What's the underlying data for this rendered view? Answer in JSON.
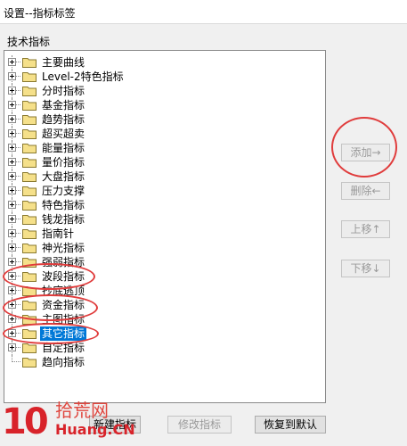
{
  "window": {
    "title": "设置--指标标签"
  },
  "group_label": "技术指标",
  "tree": {
    "items": [
      {
        "label": "主要曲线",
        "selected": false,
        "expandable": true
      },
      {
        "label": "Level-2特色指标",
        "selected": false,
        "expandable": true
      },
      {
        "label": "分时指标",
        "selected": false,
        "expandable": true
      },
      {
        "label": "基金指标",
        "selected": false,
        "expandable": true
      },
      {
        "label": "趋势指标",
        "selected": false,
        "expandable": true
      },
      {
        "label": "超买超卖",
        "selected": false,
        "expandable": true
      },
      {
        "label": "能量指标",
        "selected": false,
        "expandable": true
      },
      {
        "label": "量价指标",
        "selected": false,
        "expandable": true
      },
      {
        "label": "大盘指标",
        "selected": false,
        "expandable": true
      },
      {
        "label": "压力支撑",
        "selected": false,
        "expandable": true
      },
      {
        "label": "特色指标",
        "selected": false,
        "expandable": true
      },
      {
        "label": "钱龙指标",
        "selected": false,
        "expandable": true
      },
      {
        "label": "指南针",
        "selected": false,
        "expandable": true
      },
      {
        "label": "神光指标",
        "selected": false,
        "expandable": true
      },
      {
        "label": "强弱指标",
        "selected": false,
        "expandable": true
      },
      {
        "label": "波段指标",
        "selected": false,
        "expandable": true
      },
      {
        "label": "抄底逃顶",
        "selected": false,
        "expandable": true
      },
      {
        "label": "资金指标",
        "selected": false,
        "expandable": true
      },
      {
        "label": "主图指标",
        "selected": false,
        "expandable": true
      },
      {
        "label": "其它指标",
        "selected": true,
        "expandable": true
      },
      {
        "label": "自定指标",
        "selected": false,
        "expandable": true
      },
      {
        "label": "趋向指标",
        "selected": false,
        "expandable": false
      }
    ]
  },
  "side_buttons": {
    "add": "添加→",
    "delete": "删除←",
    "move_up": "上移↑",
    "move_down": "下移↓"
  },
  "bottom_buttons": {
    "new_indicator": "新建指标",
    "modify": "修改指标",
    "restore": "恢复到默认"
  },
  "watermark": {
    "logo": "10",
    "cn": "拾荒网",
    "en": "Huang.CN"
  },
  "colors": {
    "selection": "#0078d7",
    "folder": "#f5e08a",
    "annotation": "#e03c3c"
  }
}
